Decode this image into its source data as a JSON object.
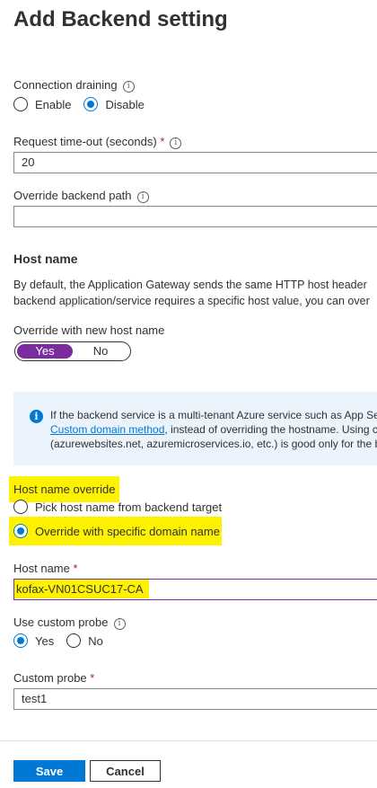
{
  "page_title": "Add Backend setting",
  "connection_draining": {
    "label": "Connection draining",
    "options": [
      "Enable",
      "Disable"
    ],
    "selected": "Disable"
  },
  "request_timeout": {
    "label": "Request time-out (seconds)",
    "required_mark": "*",
    "value": "20"
  },
  "override_backend_path": {
    "label": "Override backend path",
    "value": ""
  },
  "host_name_section": {
    "title": "Host name",
    "description_line1": "By default, the Application Gateway sends the same HTTP host header",
    "description_line2": "backend application/service requires a specific host value, you can over"
  },
  "override_new_host_name": {
    "label": "Override with new host name",
    "on_label": "Yes",
    "off_label": "No",
    "selected": "Yes"
  },
  "info_box": {
    "line1": "If the backend service is a multi-tenant Azure service such as App Ser",
    "link_text": "Custom domain method",
    "line2_rest": ", instead of overriding the hostname. Using c",
    "line3": "(azurewebsites.net, azuremicroservices.io, etc.) is good only for the ba"
  },
  "host_name_override": {
    "label": "Host name override",
    "options": [
      "Pick host name from backend target",
      "Override with specific domain name"
    ],
    "selected": "Override with specific domain name"
  },
  "host_name": {
    "label": "Host name",
    "required_mark": "*",
    "value": "kofax-VN01CSUC17-CA"
  },
  "use_custom_probe": {
    "label": "Use custom probe",
    "options": [
      "Yes",
      "No"
    ],
    "selected": "Yes"
  },
  "custom_probe": {
    "label": "Custom probe",
    "required_mark": "*",
    "value": "test1"
  },
  "footer": {
    "save_label": "Save",
    "cancel_label": "Cancel"
  },
  "colors": {
    "accent": "#0078d4",
    "toggle_on": "#7b2c9f",
    "highlight": "#fff200",
    "info_bg": "#ebf3fc"
  }
}
